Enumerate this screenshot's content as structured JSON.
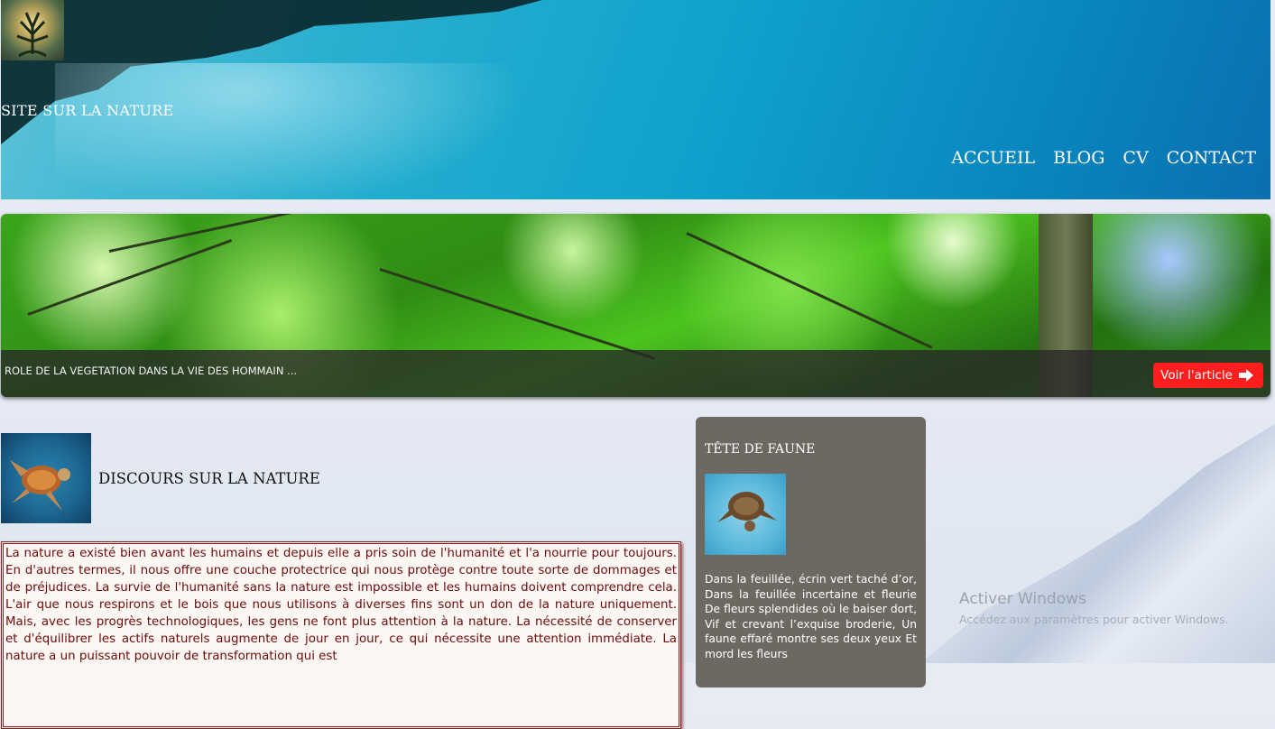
{
  "header": {
    "site_title": "SITE SUR LA NATURE",
    "nav": [
      "ACCUEIL",
      "BLOG",
      "CV",
      "CONTACT"
    ]
  },
  "hero": {
    "caption": "ROLE DE LA VEGETATION DANS LA VIE DES HOMMAIN ...",
    "button_label": "Voir l'article",
    "button_icon": "arrow-right-icon",
    "button_color": "#ff1e1e"
  },
  "article": {
    "title": "DISCOURS SUR LA NATURE",
    "body": "La nature a existé bien avant les humains et depuis elle a pris soin de l'humanité et l'a nourrie pour toujours. En d'autres termes, il nous offre une couche protectrice qui nous protège contre toute sorte de dommages et de préjudices. La survie de l'humanité sans la nature est impossible et les humains doivent comprendre cela. L'air que nous respirons et le bois que nous utilisons à diverses fins sont un don de la nature uniquement. Mais, avec les progrès technologiques, les gens ne font plus attention à la nature. La nécessité de conserver et d'équilibrer les actifs naturels augmente de jour en jour, ce qui nécessite une attention immédiate. La nature a un puissant pouvoir de transformation qui est",
    "text_color": "#6b0a0a"
  },
  "sidebar": {
    "title": "TÊTE DE FAUNE",
    "text": "Dans la feuillée, écrin vert taché d’or, Dans la feuillée incertaine et fleurie De fleurs splendides où le baiser dort, Vif et crevant l’exquise broderie, Un faune effaré montre ses deux yeux Et mord les fleurs"
  },
  "windows_watermark": {
    "title": "Activer Windows",
    "subtitle": "Accédez aux paramètres pour activer Windows."
  }
}
